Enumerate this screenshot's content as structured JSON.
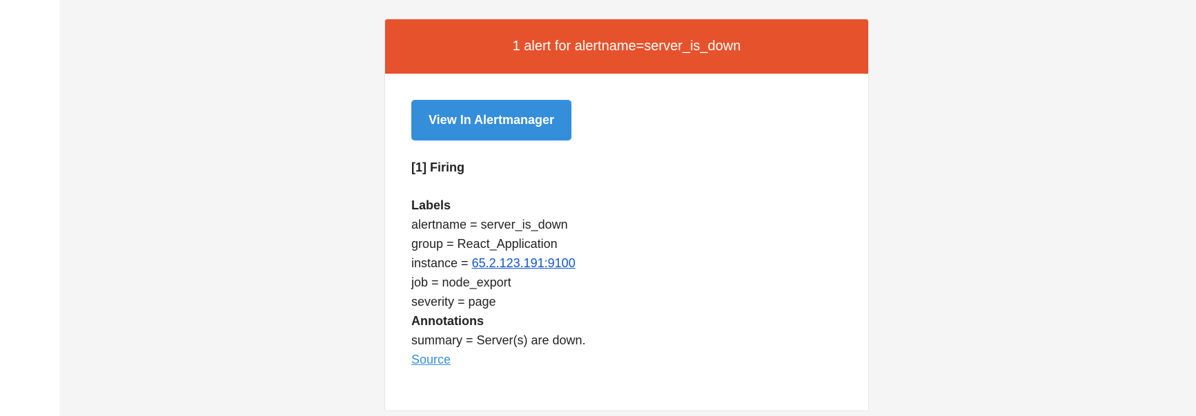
{
  "header": {
    "title": "1 alert for alertname=server_is_down"
  },
  "actions": {
    "view_button_label": "View In Alertmanager"
  },
  "firing": {
    "title": "[1] Firing"
  },
  "alert": {
    "labels_heading": "Labels",
    "labels": {
      "alertname": "alertname = server_is_down",
      "group": "group = React_Application",
      "instance_prefix": "instance = ",
      "instance_link": "65.2.123.191:9100",
      "job": "job = node_export",
      "severity": "severity = page"
    },
    "annotations_heading": "Annotations",
    "annotations": {
      "summary": "summary = Server(s) are down."
    },
    "source_link": "Source"
  },
  "colors": {
    "header_bg": "#e6522c",
    "button_bg": "#348eda",
    "page_bg": "#f5f5f5"
  }
}
